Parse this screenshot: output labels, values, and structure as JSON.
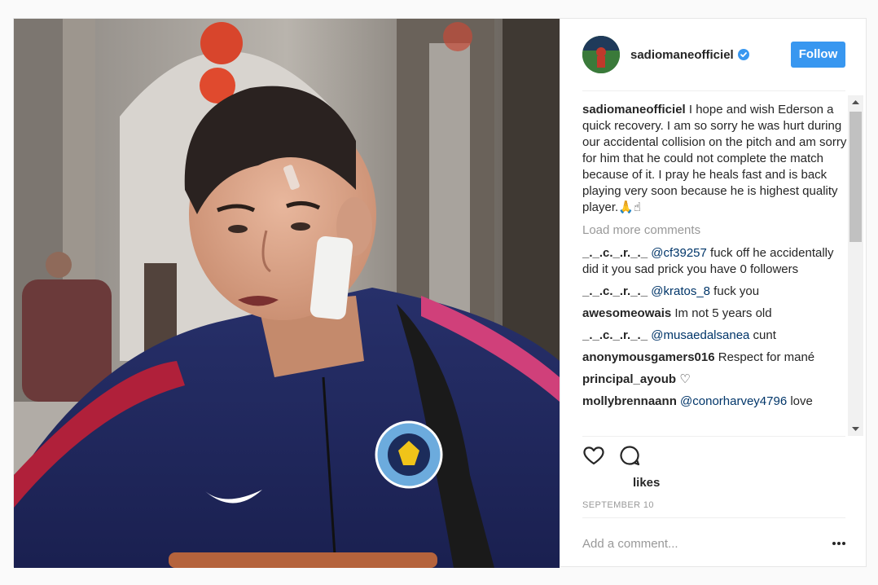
{
  "header": {
    "username": "sadiomaneofficiel",
    "follow_label": "Follow"
  },
  "caption": {
    "username": "sadiomaneofficiel",
    "text": " I hope and wish Ederson a quick recovery. I am so sorry he was hurt during our accidental collision on the pitch and am sorry for him that he could not complete the match because of it. I pray he heals fast and is back playing very soon because he is highest quality player.🙏☝"
  },
  "load_more_label": "Load more comments",
  "comments": [
    {
      "username": "_._.c._.r._._",
      "mention": "@cf39257",
      "text": " fuck off he accidentally did it you sad prick you have 0 followers"
    },
    {
      "username": "_._.c._.r._._",
      "mention": "@kratos_8",
      "text": " fuck you"
    },
    {
      "username": "awesomeowais",
      "mention": "",
      "text": " Im not 5 years old"
    },
    {
      "username": "_._.c._.r._._",
      "mention": "@musaedalsanea",
      "text": " cunt"
    },
    {
      "username": "anonymousgamers016",
      "mention": "",
      "text": " Respect for mané"
    },
    {
      "username": "principal_ayoub",
      "mention": "",
      "text": " ♡"
    },
    {
      "username": "mollybrennaann",
      "mention": "@conorharvey4796",
      "text": " love"
    }
  ],
  "likes_label": "likes",
  "date": "SEPTEMBER 10",
  "add_comment_placeholder": "Add a comment...",
  "more_label": "•••",
  "colors": {
    "follow_button": "#3897f0",
    "mention": "#003569",
    "muted": "#999999",
    "border": "#efefef"
  },
  "icons": [
    "verified-badge-icon",
    "heart-icon",
    "comment-icon",
    "more-options-icon",
    "scroll-up-arrow-icon",
    "scroll-down-arrow-icon"
  ]
}
